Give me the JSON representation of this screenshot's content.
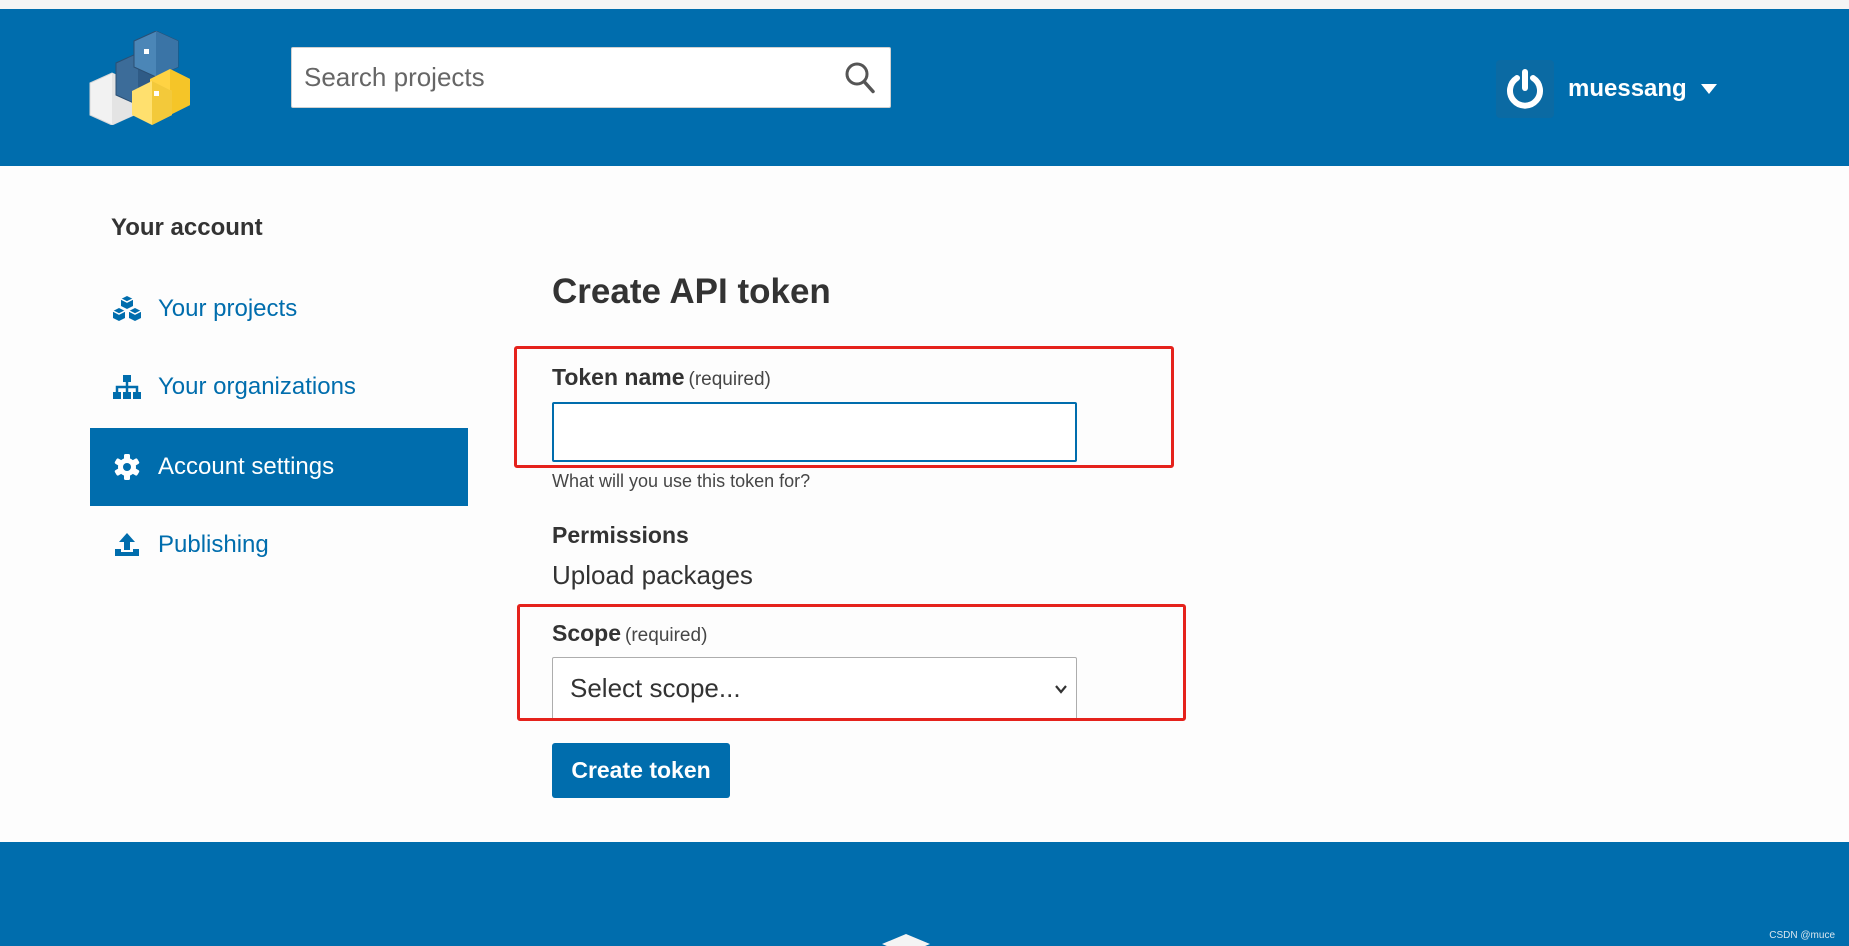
{
  "header": {
    "search": {
      "placeholder": "Search projects",
      "value": ""
    },
    "user": {
      "username": "muessang"
    }
  },
  "sidebar": {
    "title": "Your account",
    "items": [
      {
        "label": "Your projects",
        "icon": "cubes-icon",
        "active": false
      },
      {
        "label": "Your organizations",
        "icon": "sitemap-icon",
        "active": false
      },
      {
        "label": "Account settings",
        "icon": "gear-icon",
        "active": true
      },
      {
        "label": "Publishing",
        "icon": "upload-icon",
        "active": false
      }
    ]
  },
  "form": {
    "title": "Create API token",
    "token_name": {
      "label": "Token name",
      "required": "(required)",
      "value": "",
      "help": "What will you use this token for?"
    },
    "permissions": {
      "label": "Permissions",
      "value": "Upload packages"
    },
    "scope": {
      "label": "Scope",
      "required": "(required)",
      "selected": "Select scope..."
    },
    "submit_label": "Create token"
  },
  "footer": {
    "watermark": "CSDN @muce"
  },
  "colors": {
    "brand": "#006dad",
    "highlight": "#e5221c"
  }
}
